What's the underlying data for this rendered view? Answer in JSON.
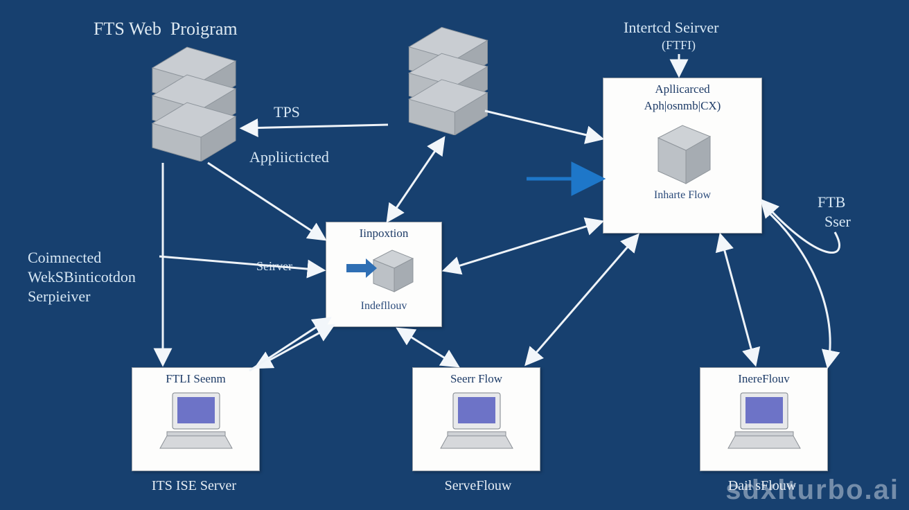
{
  "title": "FTS Web  Proigram",
  "labels": {
    "topright_a": "Intertcd Seirver",
    "topright_b": "(FTFI)",
    "tps": "TPS",
    "applicticted": "Appliicticted",
    "side_a": "Coimnected",
    "side_b": "WekSBinticotdon",
    "side_c": "Serpieiver",
    "server": "Seirver",
    "ftb": "FTB",
    "sser": "Sser"
  },
  "nodes": {
    "app_panel": {
      "line1": "Apllicarced",
      "line2": "Aph|osnmb|CX)",
      "line3": "Inharte Flow"
    },
    "center_panel": {
      "line1": "Iinpoxtion",
      "line2": "Indefllouv"
    },
    "bl_panel": {
      "line1": "FTLI Seenm"
    },
    "bm_panel": {
      "line1": "Seerr Flow"
    },
    "br_panel": {
      "line1": "InereFlouv"
    }
  },
  "captions": {
    "bl": "ITS  ISE Server",
    "bm": "ServeFlouw",
    "br": "Dail sFlouw"
  },
  "watermark": "sdxlturbo.ai"
}
